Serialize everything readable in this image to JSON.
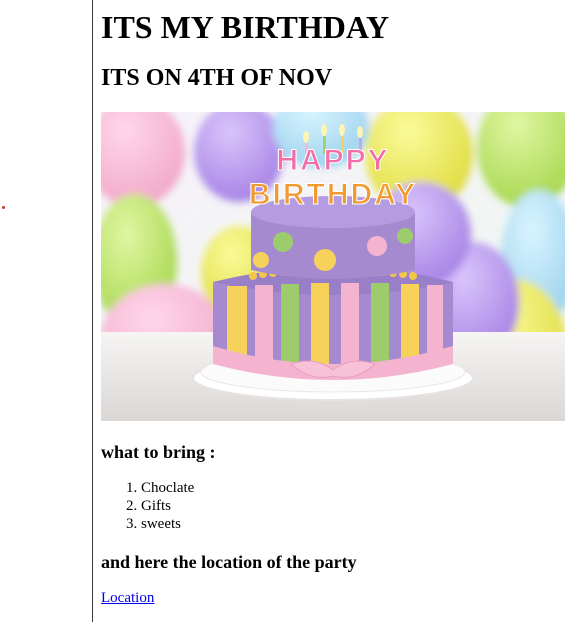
{
  "page": {
    "title": "ITS MY BIRTHDAY",
    "subtitle": "ITS ON 4TH OF NOV",
    "image": {
      "topper_line1": "HAPPY",
      "topper_line2": "BIRTHDAY",
      "description_colors": {
        "cake_purple": "#a58ad0",
        "cake_pink": "#f4b4cf",
        "cake_green": "#9ccc6b",
        "cake_yellow": "#f6d25b",
        "balloon_yellow": "#e7e84a",
        "balloon_purple": "#b895ea",
        "balloon_green": "#b6e35c"
      }
    },
    "bring": {
      "heading": "what to bring :",
      "items": [
        "Choclate",
        "Gifts",
        "sweets"
      ]
    },
    "location": {
      "heading": "and here the location of the party",
      "link_text": "Location"
    }
  }
}
